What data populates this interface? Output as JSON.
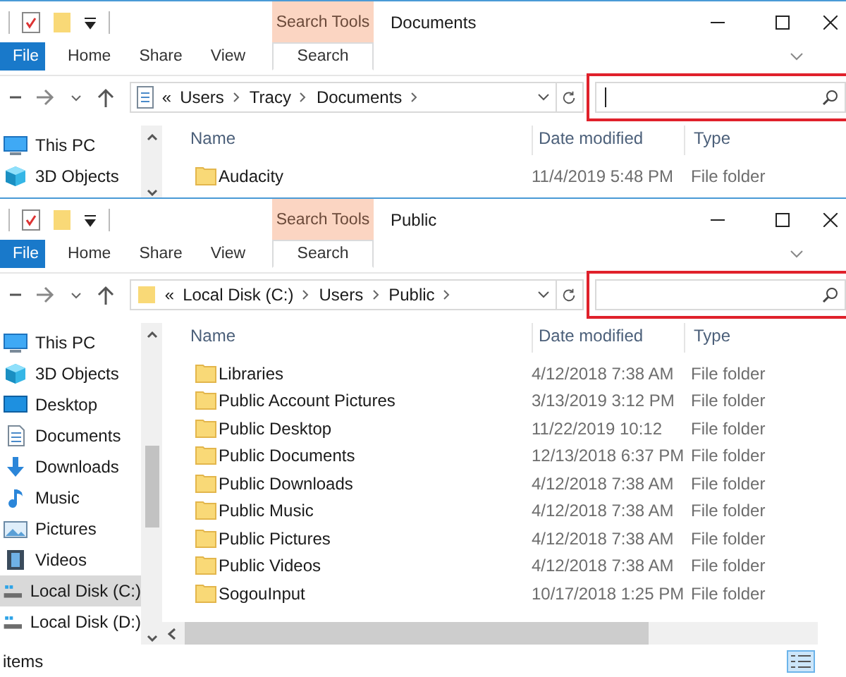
{
  "windows": [
    {
      "title": "Documents",
      "ribbon": {
        "tabs": [
          {
            "label": "File",
            "kind": "file",
            "selected": false
          },
          {
            "label": "Home",
            "kind": "tab",
            "selected": false
          },
          {
            "label": "Share",
            "kind": "tab",
            "selected": false
          },
          {
            "label": "View",
            "kind": "tab",
            "selected": false
          }
        ],
        "contextual": {
          "group": "Search Tools",
          "tab": {
            "label": "Search",
            "selected": true
          }
        }
      },
      "address": {
        "overflow": "«",
        "crumbs": [
          "Users",
          "Tracy",
          "Documents"
        ]
      },
      "search": {
        "highlighted": true,
        "focused": true
      },
      "sidebar": [
        {
          "label": "This PC",
          "kind": "pc",
          "selected": false
        },
        {
          "label": "3D Objects",
          "kind": "cube",
          "selected": false
        }
      ],
      "columns": [
        "Name",
        "Date modified",
        "Type"
      ],
      "rows": [
        {
          "name": "Audacity",
          "date": "11/4/2019 5:48 PM",
          "type": "File folder"
        }
      ]
    },
    {
      "title": "Public",
      "ribbon": {
        "tabs": [
          {
            "label": "File",
            "kind": "file",
            "selected": false
          },
          {
            "label": "Home",
            "kind": "tab",
            "selected": false
          },
          {
            "label": "Share",
            "kind": "tab",
            "selected": false
          },
          {
            "label": "View",
            "kind": "tab",
            "selected": false
          }
        ],
        "contextual": {
          "group": "Search Tools",
          "tab": {
            "label": "Search",
            "selected": true
          }
        }
      },
      "address": {
        "overflow": "«",
        "crumbs": [
          "Local Disk (C:)",
          "Users",
          "Public"
        ]
      },
      "search": {
        "highlighted": true,
        "focused": false
      },
      "sidebar": [
        {
          "label": "This PC",
          "kind": "pc",
          "selected": false
        },
        {
          "label": "3D Objects",
          "kind": "cube",
          "selected": false
        },
        {
          "label": "Desktop",
          "kind": "desktop",
          "selected": false
        },
        {
          "label": "Documents",
          "kind": "docs",
          "selected": false
        },
        {
          "label": "Downloads",
          "kind": "download",
          "selected": false
        },
        {
          "label": "Music",
          "kind": "music",
          "selected": false
        },
        {
          "label": "Pictures",
          "kind": "pictures",
          "selected": false
        },
        {
          "label": "Videos",
          "kind": "videos",
          "selected": false
        },
        {
          "label": "Local Disk (C:)",
          "kind": "disk",
          "selected": true
        },
        {
          "label": "Local Disk (D:)",
          "kind": "disk",
          "selected": false
        }
      ],
      "columns": [
        "Name",
        "Date modified",
        "Type"
      ],
      "rows": [
        {
          "name": "Libraries",
          "date": "4/12/2018 7:38 AM",
          "type": "File folder"
        },
        {
          "name": "Public Account Pictures",
          "date": "3/13/2019 3:12 PM",
          "type": "File folder"
        },
        {
          "name": "Public Desktop",
          "date": "11/22/2019 10:12",
          "type": "File folder"
        },
        {
          "name": "Public Documents",
          "date": "12/13/2018 6:37 PM",
          "type": "File folder"
        },
        {
          "name": "Public Downloads",
          "date": "4/12/2018 7:38 AM",
          "type": "File folder"
        },
        {
          "name": "Public Music",
          "date": "4/12/2018 7:38 AM",
          "type": "File folder"
        },
        {
          "name": "Public Pictures",
          "date": "4/12/2018 7:38 AM",
          "type": "File folder"
        },
        {
          "name": "Public Videos",
          "date": "4/12/2018 7:38 AM",
          "type": "File folder"
        },
        {
          "name": "SogouInput",
          "date": "10/17/2018 1:25 PM",
          "type": "File folder"
        }
      ],
      "status": "items"
    }
  ]
}
